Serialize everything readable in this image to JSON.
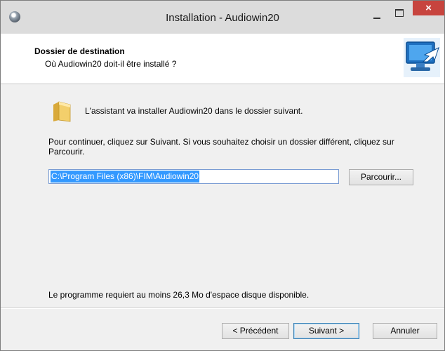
{
  "window": {
    "title": "Installation - Audiowin20",
    "controls": {
      "minimize": "–",
      "maximize": "□",
      "close": "×"
    }
  },
  "header": {
    "title": "Dossier de destination",
    "subtitle": "Où Audiowin20 doit-il être installé ?"
  },
  "content": {
    "intro": "L'assistant va installer Audiowin20 dans le dossier suivant.",
    "continue": "Pour continuer, cliquez sur Suivant. Si vous souhaitez choisir un dossier différent, cliquez sur Parcourir.",
    "path_value": "C:\\Program Files (x86)\\FIM\\Audiowin20",
    "browse_label": "Parcourir...",
    "space_required": "Le programme requiert au moins 26,3 Mo d'espace disque disponible."
  },
  "footer": {
    "back_label": "< Précédent",
    "next_label": "Suivant >",
    "cancel_label": "Annuler"
  },
  "icons": {
    "app": "installer-icon",
    "folder": "folder-icon",
    "header_graphic": "computer-arrow-icon"
  },
  "colors": {
    "selection": "#3399ff",
    "close_button": "#c7443e"
  }
}
